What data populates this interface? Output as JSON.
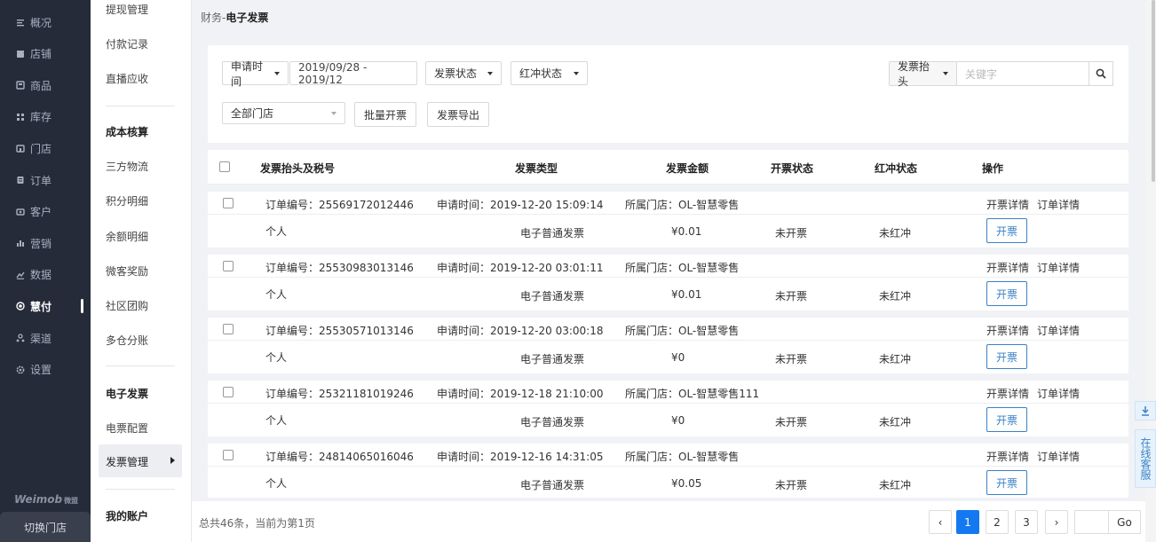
{
  "nav": {
    "items": [
      {
        "label": "概况",
        "icon": "list-icon"
      },
      {
        "label": "店铺",
        "icon": "store-icon"
      },
      {
        "label": "商品",
        "icon": "goods-icon"
      },
      {
        "label": "库存",
        "icon": "grid-icon"
      },
      {
        "label": "门店",
        "icon": "shop-icon"
      },
      {
        "label": "订单",
        "icon": "order-icon"
      },
      {
        "label": "客户",
        "icon": "customer-icon"
      },
      {
        "label": "营销",
        "icon": "chart-icon"
      },
      {
        "label": "数据",
        "icon": "data-icon"
      },
      {
        "label": "慧付",
        "icon": "pay-icon"
      },
      {
        "label": "渠道",
        "icon": "channel-icon"
      },
      {
        "label": "设置",
        "icon": "gear-icon"
      }
    ],
    "brand": "Weimob",
    "brand_cn": "微盟",
    "switch_store": "切换门店"
  },
  "subnav": {
    "items_a": [
      "提现管理",
      "付款记录",
      "直播应收"
    ],
    "head_cost": "成本核算",
    "items_b": [
      "三方物流",
      "积分明细",
      "余额明细",
      "微客奖励",
      "社区团购",
      "多仓分账"
    ],
    "head_invoice": "电子发票",
    "invoice_config": "电票配置",
    "invoice_manage": "发票管理",
    "head_account": "我的账户"
  },
  "breadcrumb": {
    "prefix": "财务-",
    "current": "电子发票"
  },
  "filters": {
    "apply_time_label": "申请时间",
    "date_range": "2019/09/28 - 2019/12",
    "invoice_status": "发票状态",
    "red_status": "红冲状态",
    "title_select": "发票抬头",
    "keyword_placeholder": "关键字",
    "store_select": "全部门店",
    "batch_button": "批量开票",
    "export_button": "发票导出"
  },
  "table": {
    "headers": [
      "发票抬头及税号",
      "发票类型",
      "发票金额",
      "开票状态",
      "红冲状态",
      "操作"
    ],
    "order_no_label": "订单编号：",
    "apply_time_label": "申请时间：",
    "store_label": "所属门店：",
    "action_detail": "开票详情",
    "action_order": "订单详情",
    "open_button": "开票",
    "rows": [
      {
        "order_no": "25569172012446",
        "time": "2019-12-20 15:09:14",
        "store": "OL-智慧零售",
        "title": "个人",
        "type": "电子普通发票",
        "amount": "¥0.01",
        "status": "未开票",
        "red": "未红冲"
      },
      {
        "order_no": "25530983013146",
        "time": "2019-12-20 03:01:11",
        "store": "OL-智慧零售",
        "title": "个人",
        "type": "电子普通发票",
        "amount": "¥0.01",
        "status": "未开票",
        "red": "未红冲"
      },
      {
        "order_no": "25530571013146",
        "time": "2019-12-20 03:00:18",
        "store": "OL-智慧零售",
        "title": "个人",
        "type": "电子普通发票",
        "amount": "¥0",
        "status": "未开票",
        "red": "未红冲"
      },
      {
        "order_no": "25321181019246",
        "time": "2019-12-18 21:10:00",
        "store": "OL-智慧零售111",
        "title": "个人",
        "type": "电子普通发票",
        "amount": "¥0",
        "status": "未开票",
        "red": "未红冲"
      },
      {
        "order_no": "24814065016046",
        "time": "2019-12-16 14:31:05",
        "store": "OL-智慧零售",
        "title": "个人",
        "type": "电子普通发票",
        "amount": "¥0.05",
        "status": "未开票",
        "red": "未红冲"
      }
    ]
  },
  "pagination": {
    "total_text": "总共46条，当前为第1页",
    "prev": "‹",
    "pages": [
      "1",
      "2",
      "3"
    ],
    "current": "1",
    "next": "›",
    "go": "Go"
  },
  "side": {
    "customer_service": "在线客服"
  },
  "colors": {
    "accent": "#1478f0",
    "nav_bg": "#262b3a",
    "link_blue": "#3b82c4"
  }
}
